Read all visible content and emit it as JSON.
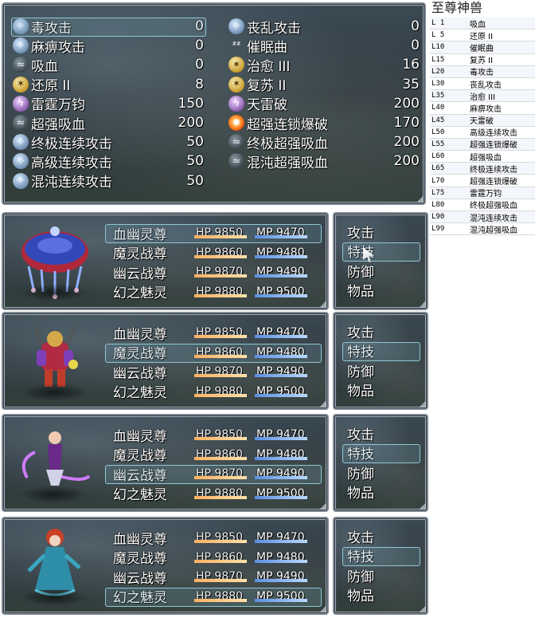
{
  "skill_window": {
    "left": [
      {
        "name": "毒攻击",
        "cost": "0",
        "icon": "poison-icon",
        "selected": true
      },
      {
        "name": "麻痹攻击",
        "cost": "0",
        "icon": "paralyze-icon"
      },
      {
        "name": "吸血",
        "cost": "0",
        "icon": "drain-icon"
      },
      {
        "name": "还原 II",
        "cost": "8",
        "icon": "restore-icon"
      },
      {
        "name": "雷霆万钧",
        "cost": "150",
        "icon": "thunder-icon"
      },
      {
        "name": "超强吸血",
        "cost": "200",
        "icon": "drain-icon"
      },
      {
        "name": "终极连续攻击",
        "cost": "50",
        "icon": "combo-icon"
      },
      {
        "name": "高级连续攻击",
        "cost": "50",
        "icon": "combo-icon"
      },
      {
        "name": "混沌连续攻击",
        "cost": "50",
        "icon": "combo-icon"
      }
    ],
    "right": [
      {
        "name": "丧乱攻击",
        "cost": "0",
        "icon": "confuse-icon"
      },
      {
        "name": "催眠曲",
        "cost": "0",
        "icon": "sleep-icon"
      },
      {
        "name": "治愈 III",
        "cost": "16",
        "icon": "heal-icon"
      },
      {
        "name": "复苏 II",
        "cost": "35",
        "icon": "revive-icon"
      },
      {
        "name": "天雷破",
        "cost": "200",
        "icon": "thunder-icon"
      },
      {
        "name": "超强连锁爆破",
        "cost": "170",
        "icon": "explosion-icon"
      },
      {
        "name": "终极超强吸血",
        "cost": "200",
        "icon": "drain-icon"
      },
      {
        "name": "混沌超强吸血",
        "cost": "200",
        "icon": "drain-icon"
      }
    ]
  },
  "party": {
    "members": [
      {
        "name": "血幽灵尊",
        "hp": "HP 9850",
        "mp": "MP 9470"
      },
      {
        "name": "魔灵战尊",
        "hp": "HP 9860",
        "mp": "MP 9480"
      },
      {
        "name": "幽云战尊",
        "hp": "HP 9870",
        "mp": "MP 9490"
      },
      {
        "name": "幻之魅灵",
        "hp": "HP 9880",
        "mp": "MP 9500"
      }
    ],
    "commands": [
      "攻击",
      "特技",
      "防御",
      "物品"
    ],
    "selected_command": "特技",
    "panels": [
      {
        "active_member": 0,
        "portrait": "jellyfish-monster-portrait"
      },
      {
        "active_member": 1,
        "portrait": "armored-warrior-portrait"
      },
      {
        "active_member": 2,
        "portrait": "scythe-dancer-portrait"
      },
      {
        "active_member": 3,
        "portrait": "blue-spirit-portrait"
      }
    ]
  },
  "learn_table": {
    "title": "至尊神兽",
    "rows": [
      {
        "level": "L 1",
        "skill": "吸血"
      },
      {
        "level": "L 5",
        "skill": "还原 II"
      },
      {
        "level": "L10",
        "skill": "催眠曲"
      },
      {
        "level": "L15",
        "skill": "复苏 II"
      },
      {
        "level": "L20",
        "skill": "毒攻击"
      },
      {
        "level": "L30",
        "skill": "丧乱攻击"
      },
      {
        "level": "L35",
        "skill": "治愈 III"
      },
      {
        "level": "L40",
        "skill": "麻痹攻击"
      },
      {
        "level": "L45",
        "skill": "天雷破"
      },
      {
        "level": "L50",
        "skill": "高级连续攻击"
      },
      {
        "level": "L55",
        "skill": "超强连锁爆破"
      },
      {
        "level": "L60",
        "skill": "超强吸血"
      },
      {
        "level": "L65",
        "skill": "终极连续攻击"
      },
      {
        "level": "L70",
        "skill": "超强连锁爆破"
      },
      {
        "level": "L75",
        "skill": "雷霆万钧"
      },
      {
        "level": "L80",
        "skill": "终极超强吸血"
      },
      {
        "level": "L90",
        "skill": "混沌连续攻击"
      },
      {
        "level": "L99",
        "skill": "混沌超强吸血"
      }
    ]
  }
}
